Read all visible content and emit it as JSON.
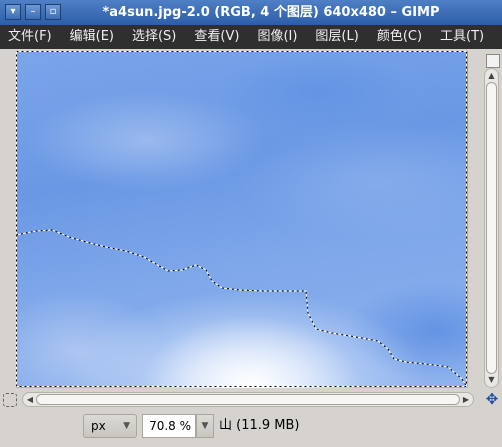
{
  "window": {
    "title": "*a4sun.jpg-2.0 (RGB, 4 个图层) 640x480 – GIMP",
    "buttons": {
      "menu": "▾",
      "minimize": "–",
      "maximize": "▫"
    }
  },
  "menubar": {
    "items": [
      "文件(F)",
      "编辑(E)",
      "选择(S)",
      "查看(V)",
      "图像(I)",
      "图层(L)",
      "颜色(C)",
      "工具(T)"
    ]
  },
  "canvas": {
    "image": "sky with clouds",
    "selection": "marching ants selection boundary"
  },
  "scrollbars": {
    "vertical_arrow_up": "▲",
    "vertical_arrow_down": "▼",
    "horizontal_arrow_left": "◀",
    "horizontal_arrow_right": "▶"
  },
  "icons": {
    "zoom_toggle": "zoom-toggle-icon",
    "quick_mask": "quick-mask-icon",
    "navigate": "navigate-icon",
    "navigate_glyph": "✥"
  },
  "statusbar": {
    "unit": "px",
    "zoom": "70.8 %",
    "status": "山 (11.9 MB)",
    "caret": "▼"
  }
}
